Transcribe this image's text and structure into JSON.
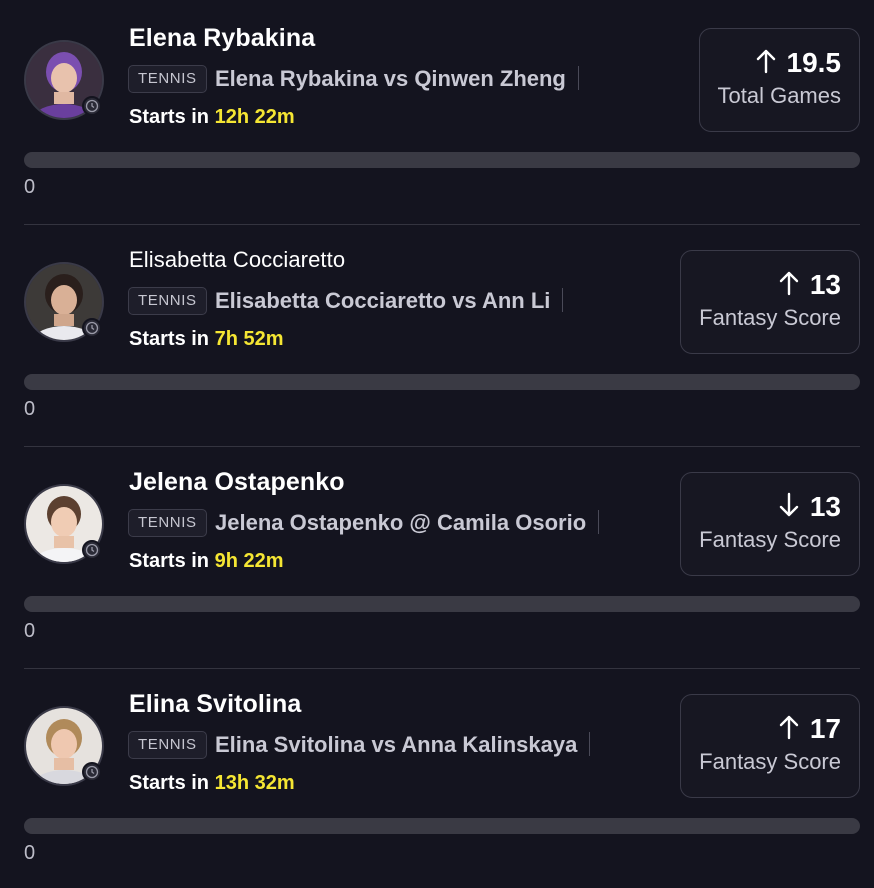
{
  "cards": [
    {
      "player": "Elena Rybakina",
      "sport_tag": "TENNIS",
      "matchup": "Elena Rybakina vs Qinwen Zheng",
      "starts_prefix": "Starts in ",
      "starts_time": "12h 22m",
      "direction": "up",
      "stat_value": "19.5",
      "stat_label": "Total Games",
      "count": "0",
      "progress": 0
    },
    {
      "player": "Elisabetta Cocciaretto",
      "sport_tag": "TENNIS",
      "matchup": "Elisabetta Cocciaretto vs Ann Li",
      "starts_prefix": "Starts in ",
      "starts_time": "7h 52m",
      "direction": "up",
      "stat_value": "13",
      "stat_label": "Fantasy Score",
      "count": "0",
      "progress": 0
    },
    {
      "player": "Jelena Ostapenko",
      "sport_tag": "TENNIS",
      "matchup": "Jelena Ostapenko @ Camila Osorio",
      "starts_prefix": "Starts in ",
      "starts_time": "9h 22m",
      "direction": "down",
      "stat_value": "13",
      "stat_label": "Fantasy Score",
      "count": "0",
      "progress": 0
    },
    {
      "player": "Elina Svitolina",
      "sport_tag": "TENNIS",
      "matchup": "Elina Svitolina vs Anna Kalinskaya",
      "starts_prefix": "Starts in ",
      "starts_time": "13h 32m",
      "direction": "up",
      "stat_value": "17",
      "stat_label": "Fantasy Score",
      "count": "0",
      "progress": 0
    }
  ],
  "colors": {
    "background": "#14141f",
    "accent_time": "#f5e633",
    "progress_track": "#3a3a44",
    "muted_text": "#c9c9d4"
  },
  "icons": {
    "up": "arrow-up-icon",
    "down": "arrow-down-icon",
    "clock": "clock-icon"
  }
}
